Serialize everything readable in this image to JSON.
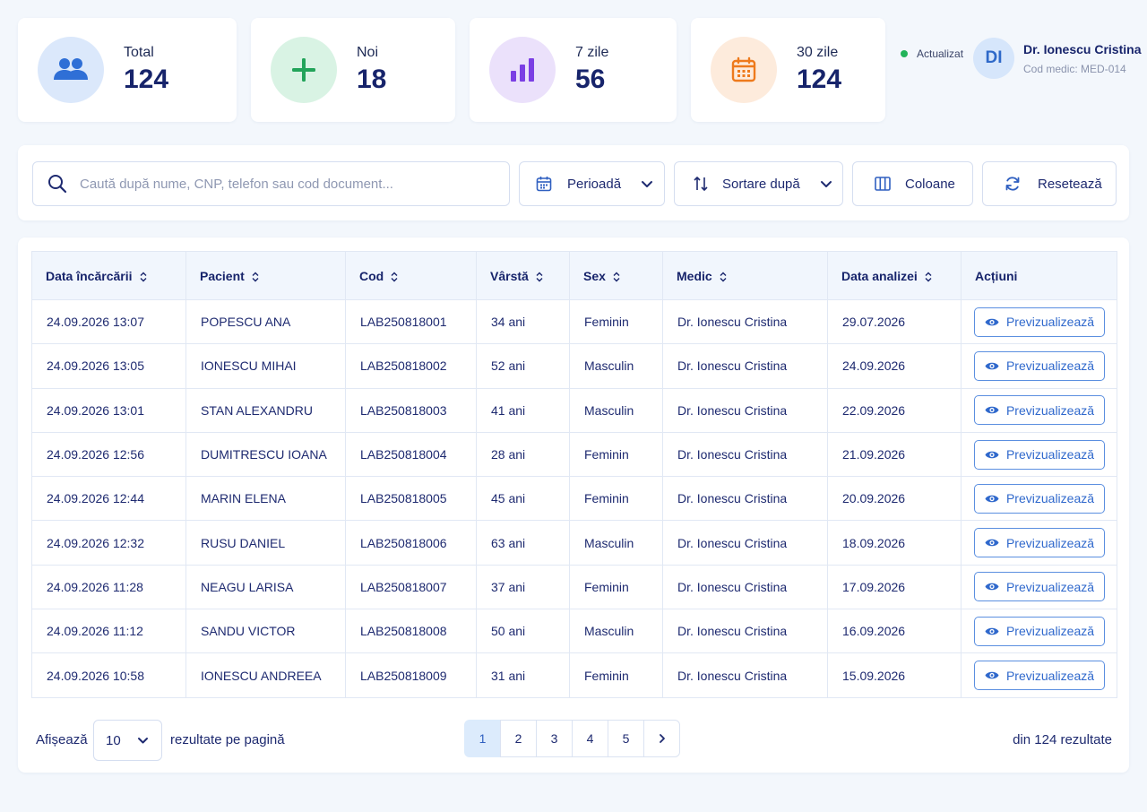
{
  "stats": [
    {
      "label": "Total",
      "value": "124",
      "icon": "users-icon",
      "bg": "#dbe8fb",
      "color": "#2f6fd6"
    },
    {
      "label": "Noi",
      "value": "18",
      "icon": "plus-icon",
      "bg": "#d9f3e4",
      "color": "#22a45a"
    },
    {
      "label": "7 zile",
      "value": "56",
      "icon": "bar-chart-icon",
      "bg": "#ebe1fb",
      "color": "#7b3fe4"
    },
    {
      "label": "30 zile",
      "value": "124",
      "icon": "calendar-icon",
      "bg": "#fdebdc",
      "color": "#ee7a1c"
    }
  ],
  "status": {
    "label": "Actualizat",
    "color": "#22b45a"
  },
  "user": {
    "initials": "DI",
    "name": "Dr. Ionescu Cristina",
    "code": "Cod medic: MED-014"
  },
  "filters": {
    "search_placeholder": "Caută după nume, CNP, telefon sau cod document...",
    "period_label": "Perioadă",
    "sort_label": "Sortare după",
    "columns_label": "Coloane",
    "reset_label": "Resetează"
  },
  "table": {
    "headers": [
      "Data încărcării",
      "Pacient",
      "Cod",
      "Vârstă",
      "Sex",
      "Medic",
      "Data analizei",
      "Acțiuni"
    ],
    "preview_label": "Previzualizează",
    "rows": [
      {
        "uploaded": "24.09.2026 13:07",
        "patient": "POPESCU ANA",
        "code": "LAB250818001",
        "age": "34 ani",
        "sex": "Feminin",
        "doctor": "Dr. Ionescu Cristina",
        "analysis_date": "29.07.2026"
      },
      {
        "uploaded": "24.09.2026 13:05",
        "patient": "IONESCU MIHAI",
        "code": "LAB250818002",
        "age": "52 ani",
        "sex": "Masculin",
        "doctor": "Dr. Ionescu Cristina",
        "analysis_date": "24.09.2026"
      },
      {
        "uploaded": "24.09.2026 13:01",
        "patient": "STAN ALEXANDRU",
        "code": "LAB250818003",
        "age": "41 ani",
        "sex": "Masculin",
        "doctor": "Dr. Ionescu Cristina",
        "analysis_date": "22.09.2026"
      },
      {
        "uploaded": "24.09.2026 12:56",
        "patient": "DUMITRESCU IOANA",
        "code": "LAB250818004",
        "age": "28 ani",
        "sex": "Feminin",
        "doctor": "Dr. Ionescu Cristina",
        "analysis_date": "21.09.2026"
      },
      {
        "uploaded": "24.09.2026 12:44",
        "patient": "MARIN ELENA",
        "code": "LAB250818005",
        "age": "45 ani",
        "sex": "Feminin",
        "doctor": "Dr. Ionescu Cristina",
        "analysis_date": "20.09.2026"
      },
      {
        "uploaded": "24.09.2026 12:32",
        "patient": "RUSU DANIEL",
        "code": "LAB250818006",
        "age": "63 ani",
        "sex": "Masculin",
        "doctor": "Dr. Ionescu Cristina",
        "analysis_date": "18.09.2026"
      },
      {
        "uploaded": "24.09.2026 11:28",
        "patient": "NEAGU LARISA",
        "code": "LAB250818007",
        "age": "37 ani",
        "sex": "Feminin",
        "doctor": "Dr. Ionescu Cristina",
        "analysis_date": "17.09.2026"
      },
      {
        "uploaded": "24.09.2026 11:12",
        "patient": "SANDU VICTOR",
        "code": "LAB250818008",
        "age": "50 ani",
        "sex": "Masculin",
        "doctor": "Dr. Ionescu Cristina",
        "analysis_date": "16.09.2026"
      },
      {
        "uploaded": "24.09.2026 10:58",
        "patient": "IONESCU ANDREEA",
        "code": "LAB250818009",
        "age": "31 ani",
        "sex": "Feminin",
        "doctor": "Dr. Ionescu Cristina",
        "analysis_date": "15.09.2026"
      }
    ]
  },
  "pagination": {
    "show_label": "Afișează",
    "per_page": "10",
    "per_page_suffix": "rezultate pe pagină",
    "pages": [
      "1",
      "2",
      "3",
      "4",
      "5"
    ],
    "current_page": "1",
    "next_icon": "chevron-right-icon",
    "total_label": "din 124 rezultate"
  }
}
